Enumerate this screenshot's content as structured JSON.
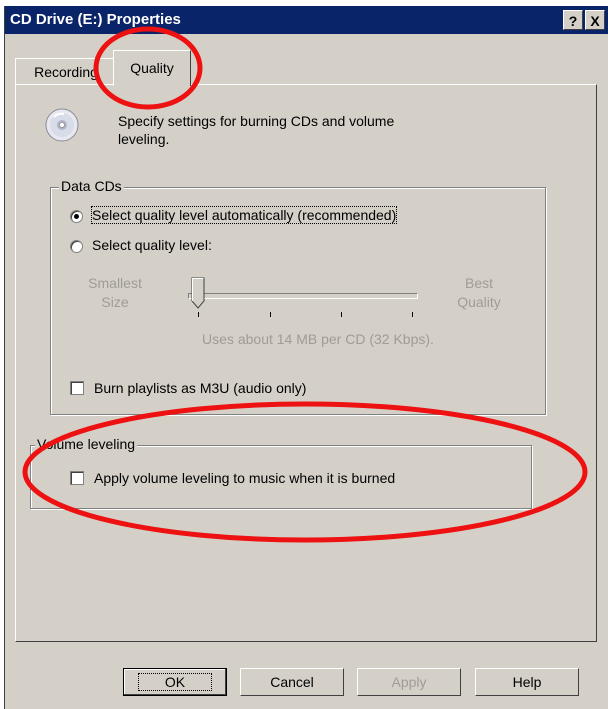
{
  "window": {
    "title": "CD Drive (E:) Properties",
    "help_label": "?",
    "close_label": "X"
  },
  "tabs": [
    {
      "label": "Recording",
      "selected": false
    },
    {
      "label": "Quality",
      "selected": true
    }
  ],
  "intro": {
    "icon": "cd-disc-icon",
    "text": "Specify settings for burning CDs and volume leveling."
  },
  "data_cds": {
    "legend": "Data CDs",
    "auto_option": {
      "label": "Select quality level automatically (recommended)",
      "selected": true
    },
    "manual_option": {
      "label": "Select quality level:",
      "selected": false
    },
    "slider": {
      "left_label": "Smallest Size",
      "right_label": "Best Quality",
      "level": 0,
      "ticks": 5,
      "enabled": false
    },
    "usage_text": "Uses about 14 MB per CD (32 Kbps).",
    "m3u_checkbox": {
      "label": "Burn playlists as M3U (audio only)",
      "checked": false
    }
  },
  "volume_leveling": {
    "legend": "Volume leveling",
    "checkbox": {
      "label": "Apply volume leveling to music when it is burned",
      "checked": false
    }
  },
  "buttons": {
    "ok": "OK",
    "cancel": "Cancel",
    "apply": "Apply",
    "help": "Help"
  },
  "colors": {
    "titlebar": "#0a246a",
    "face": "#d4d0c8",
    "disabled_text": "#a09c94",
    "annotation": "#ee1111"
  }
}
